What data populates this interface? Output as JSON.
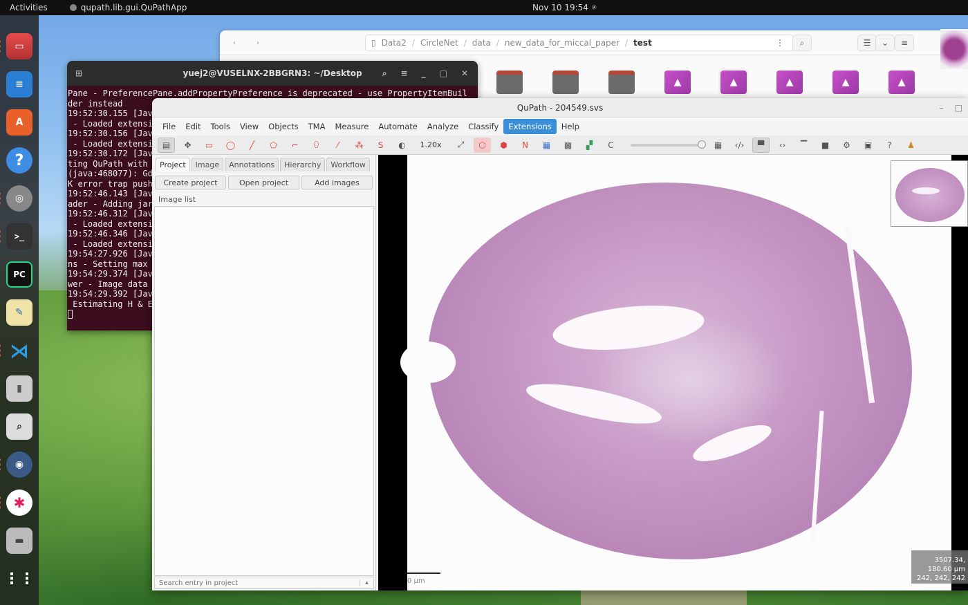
{
  "topbar": {
    "activities": "Activities",
    "app_name": "qupath.lib.gui.QuPathApp",
    "clock": "Nov 10  19:54"
  },
  "dock": {
    "items": [
      {
        "name": "files",
        "icon": "folder-icon"
      },
      {
        "name": "writer",
        "icon": "document-icon"
      },
      {
        "name": "software",
        "icon": "shopping-bag-icon"
      },
      {
        "name": "help",
        "icon": "help-icon",
        "glyph": "?"
      },
      {
        "name": "disc",
        "icon": "disc-icon"
      },
      {
        "name": "terminal",
        "icon": "terminal-icon",
        "glyph": ">_"
      },
      {
        "name": "pycharm",
        "icon": "pycharm-icon",
        "glyph": "PC"
      },
      {
        "name": "text-editor",
        "icon": "pencil-icon"
      },
      {
        "name": "vscode",
        "icon": "vscode-icon"
      },
      {
        "name": "usb",
        "icon": "usb-icon"
      },
      {
        "name": "search",
        "icon": "magnifier-icon"
      },
      {
        "name": "qupath",
        "icon": "qupath-icon"
      },
      {
        "name": "slack",
        "icon": "slack-icon"
      },
      {
        "name": "disk",
        "icon": "drive-icon"
      },
      {
        "name": "apps",
        "icon": "grid-icon"
      }
    ]
  },
  "file_manager": {
    "breadcrumbs": [
      "Data2",
      "CircleNet",
      "data",
      "new_data_for_miccal_paper",
      "test"
    ]
  },
  "terminal": {
    "title": "yuej2@VUSELNX-2BBGRN3: ~/Desktop",
    "lines": [
      "Pane - PreferencePane.addPropertyPreference is deprecated - use PropertyItemBuil",
      "der instead",
      "19:52:30.155 [Jav",
      " - Loaded extensi",
      "19:52:30.156 [Jav",
      " - Loaded extensi",
      "19:52:30.172 [Jav",
      "ting QuPath with ",
      "",
      "(java:468077): Gd",
      "K error trap push",
      "19:52:46.143 [Jav",
      "ader - Adding jar",
      "19:52:46.312 [Jav",
      " - Loaded extensi",
      "19:52:46.346 [Jav",
      " - Loaded extensi",
      "19:54:27.926 [Jav",
      "ns - Setting max ",
      "19:54:29.374 [Jav",
      "wer - Image data ",
      "19:54:29.392 [Jav",
      " Estimating H & E"
    ]
  },
  "qupath": {
    "title": "QuPath - 204549.svs",
    "menu": [
      "File",
      "Edit",
      "Tools",
      "View",
      "Objects",
      "TMA",
      "Measure",
      "Automate",
      "Analyze",
      "Classify",
      "Extensions",
      "Help"
    ],
    "active_menu": "Extensions",
    "zoom": "1.20x",
    "tabs": [
      "Project",
      "Image",
      "Annotations",
      "Hierarchy",
      "Workflow"
    ],
    "active_tab": "Project",
    "project_buttons": [
      "Create project",
      "Open project",
      "Add images"
    ],
    "image_list_label": "Image list",
    "search_placeholder": "Search entry in project",
    "scale_label": "0 µm",
    "coords_line1": "3507.34, 180.60 µm",
    "coords_line2": "242, 242, 242"
  }
}
